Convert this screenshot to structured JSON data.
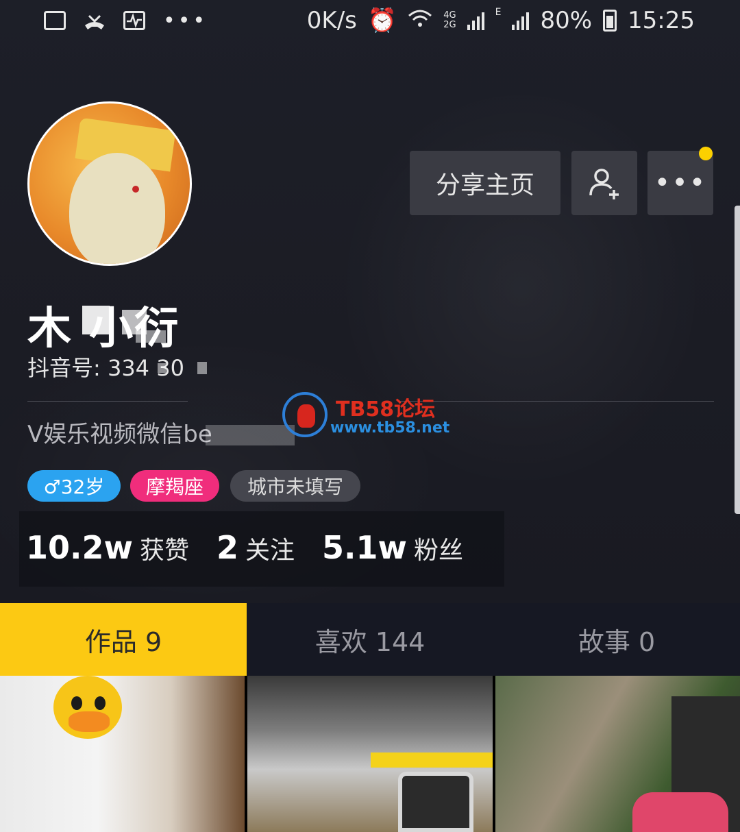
{
  "status_bar": {
    "net_speed": "0K/s",
    "net_4g": "4G",
    "net_2g": "2G",
    "net_e": "E",
    "battery": "80%",
    "time": "15:25"
  },
  "profile": {
    "nickname": "木  小衍",
    "douyin_id": "抖音号: 334      30",
    "bio": "V娱乐视频微信be"
  },
  "actions": {
    "share_label": "分享主页",
    "more_label": "•••"
  },
  "tags": {
    "gender_age": "♂32岁",
    "zodiac": "摩羯座",
    "city": "城市未填写"
  },
  "stats": [
    {
      "num": "10.2w",
      "label": "获赞"
    },
    {
      "num": "2",
      "label": "关注"
    },
    {
      "num": "5.1w",
      "label": "粉丝"
    }
  ],
  "tabs": [
    {
      "label": "作品 9",
      "active": true
    },
    {
      "label": "喜欢 144",
      "active": false
    },
    {
      "label": "故事 0",
      "active": false
    }
  ],
  "watermark": {
    "title": "TB58论坛",
    "url": "www.tb58.net"
  },
  "colors": {
    "accent_yellow": "#fcc913",
    "gender_blue": "#2ba3f0",
    "zodiac_pink": "#f02d7c",
    "background": "#161823"
  }
}
